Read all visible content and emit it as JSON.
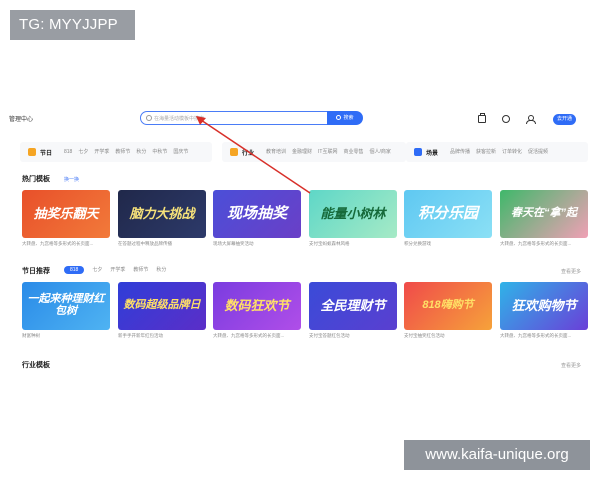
{
  "watermark": {
    "top_left": "TG: MYYJJPP",
    "bottom_right": "www.kaifa-unique.org"
  },
  "header": {
    "brand": "管理中心",
    "search": {
      "placeholder": "在海量活动模板中搜索",
      "button_label": "搜索"
    },
    "icons": [
      "briefcase-icon",
      "headset-icon",
      "user-icon"
    ],
    "vip_label": "去开通"
  },
  "categories": [
    {
      "title": "节日",
      "color": "#f5a524",
      "items": [
        "818",
        "七夕",
        "开学季",
        "教师节",
        "秋分",
        "中秋节",
        "国庆节"
      ]
    },
    {
      "title": "行业",
      "color": "#f5a524",
      "items": [
        "教育培训",
        "金融理财",
        "IT互联网",
        "商业零售",
        "個人/商家"
      ]
    },
    {
      "title": "场景",
      "color": "#2f6cf6",
      "items": [
        "品牌传播",
        "获客拉新",
        "订单转化",
        "促活提频"
      ]
    }
  ],
  "hot": {
    "title": "热门模板",
    "switch_label": "换一换",
    "cards": [
      {
        "text": "抽奖乐翻天",
        "caption": "大转盘、九宫格等多形式的长页面...",
        "bg": "#e8502a",
        "bg2": "#f27a3a",
        "fg": "#ffffff"
      },
      {
        "text": "脑力大挑战",
        "caption": "在答题过程中释放品牌传播",
        "bg": "#20284a",
        "bg2": "#2d3a6a",
        "fg": "#f6e27a"
      },
      {
        "text": "现场抽奖",
        "caption": "现场大屏幕抽奖活动",
        "bg": "#4b4fd8",
        "bg2": "#6a3fc7",
        "fg": "#ffffff"
      },
      {
        "text": "能量小树林",
        "caption": "支付宝蚂蚁森林风格",
        "bg": "#5ed7c7",
        "bg2": "#a6eac6",
        "fg": "#166a3a"
      },
      {
        "text": "积分乐园",
        "caption": "积分兑换游戏",
        "bg": "#5fc8f2",
        "bg2": "#8be0f5",
        "fg": "#ffffff"
      },
      {
        "text": "春天在“拿”起",
        "caption": "大转盘、九宫格等多形式的长页面...",
        "bg": "#3fb86a",
        "bg2": "#f0a0b5",
        "fg": "#ffffff"
      }
    ]
  },
  "festival": {
    "title": "节日推荐",
    "tabs": [
      "818",
      "七夕",
      "开学季",
      "教师节",
      "秋分"
    ],
    "more_label": "查看更多",
    "cards": [
      {
        "text": "一起来种理财红包树",
        "caption": "财富种树",
        "bg": "#2a8be8",
        "bg2": "#4fb3f2",
        "fg": "#ffffff"
      },
      {
        "text": "数码超级品牌日",
        "caption": "新手手开新年红包活动",
        "bg": "#2f3ed8",
        "bg2": "#5b2ec8",
        "fg": "#ffe066"
      },
      {
        "text": "数码狂欢节",
        "caption": "大转盘、九宫格等多形式的长页面...",
        "bg": "#7a3ce0",
        "bg2": "#b04ee8",
        "fg": "#ffe066"
      },
      {
        "text": "全民理财节",
        "caption": "支付宝答题红包活动",
        "bg": "#3a4bd8",
        "bg2": "#5a3fd0",
        "fg": "#ffffff"
      },
      {
        "text": "818嗨购节",
        "caption": "支付宝抽奖红包活动",
        "bg": "#f04a4a",
        "bg2": "#f6a23a",
        "fg": "#ffe066"
      },
      {
        "text": "狂欢购物节",
        "caption": "大转盘、九宫格等多形式的长页面...",
        "bg": "#2fb3e8",
        "bg2": "#6a3fd8",
        "fg": "#ffffff"
      }
    ]
  },
  "industry": {
    "title": "行业模板",
    "more_label": "查看更多"
  },
  "annotation_arrow_color": "#d8302a"
}
